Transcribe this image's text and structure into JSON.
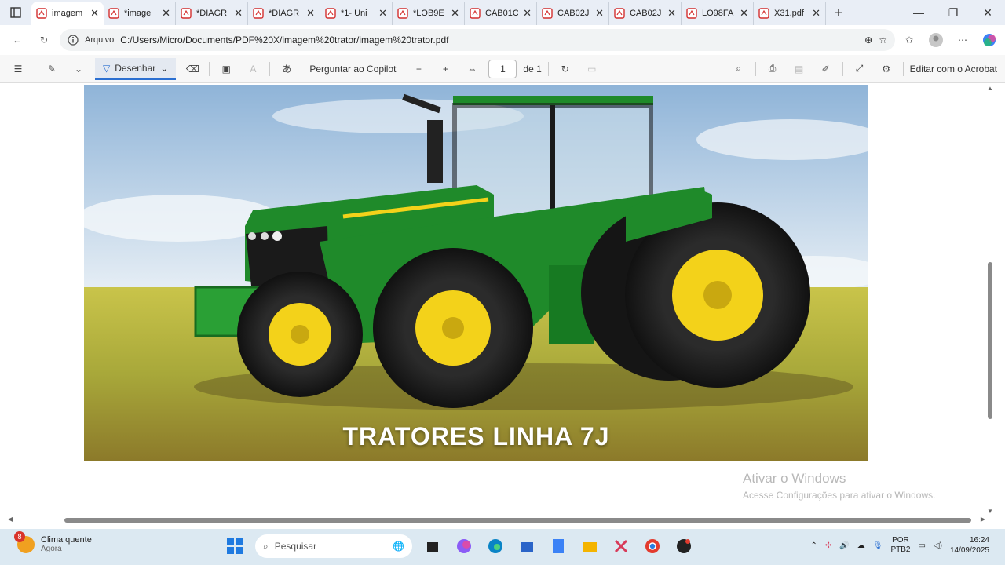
{
  "browser": {
    "tabs": [
      {
        "title": "imagem",
        "active": true
      },
      {
        "title": "*image",
        "active": false
      },
      {
        "title": "*DIAGR",
        "active": false
      },
      {
        "title": "*DIAGR",
        "active": false
      },
      {
        "title": "*1- Uni",
        "active": false
      },
      {
        "title": "*LOB9E",
        "active": false
      },
      {
        "title": "CAB01C",
        "active": false
      },
      {
        "title": "CAB02J",
        "active": false
      },
      {
        "title": "CAB02J",
        "active": false
      },
      {
        "title": "LO98FA",
        "active": false
      },
      {
        "title": "X31.pdf",
        "active": false
      }
    ],
    "address": {
      "label": "Arquivo",
      "url": "C:/Users/Micro/Documents/PDF%20X/imagem%20trator/imagem%20trator.pdf"
    }
  },
  "pdf_toolbar": {
    "draw_label": "Desenhar",
    "copilot_label": "Perguntar ao Copilot",
    "page_current": "1",
    "page_total": "de 1",
    "acrobat_label": "Editar com o Acrobat"
  },
  "document": {
    "caption": "TRATORES LINHA 7J",
    "watermark_title": "Ativar o Windows",
    "watermark_sub": "Acesse Configurações para ativar o Windows."
  },
  "taskbar": {
    "weather_title": "Clima quente",
    "weather_sub": "Agora",
    "weather_badge": "8",
    "search_placeholder": "Pesquisar",
    "lang_1": "POR",
    "lang_2": "PTB2",
    "time": "16:24",
    "date": "14/09/2025"
  },
  "colors": {
    "tractor_green": "#1f8a2a",
    "wheel_yellow": "#f3d21a",
    "accent_blue": "#2b6fd1"
  }
}
